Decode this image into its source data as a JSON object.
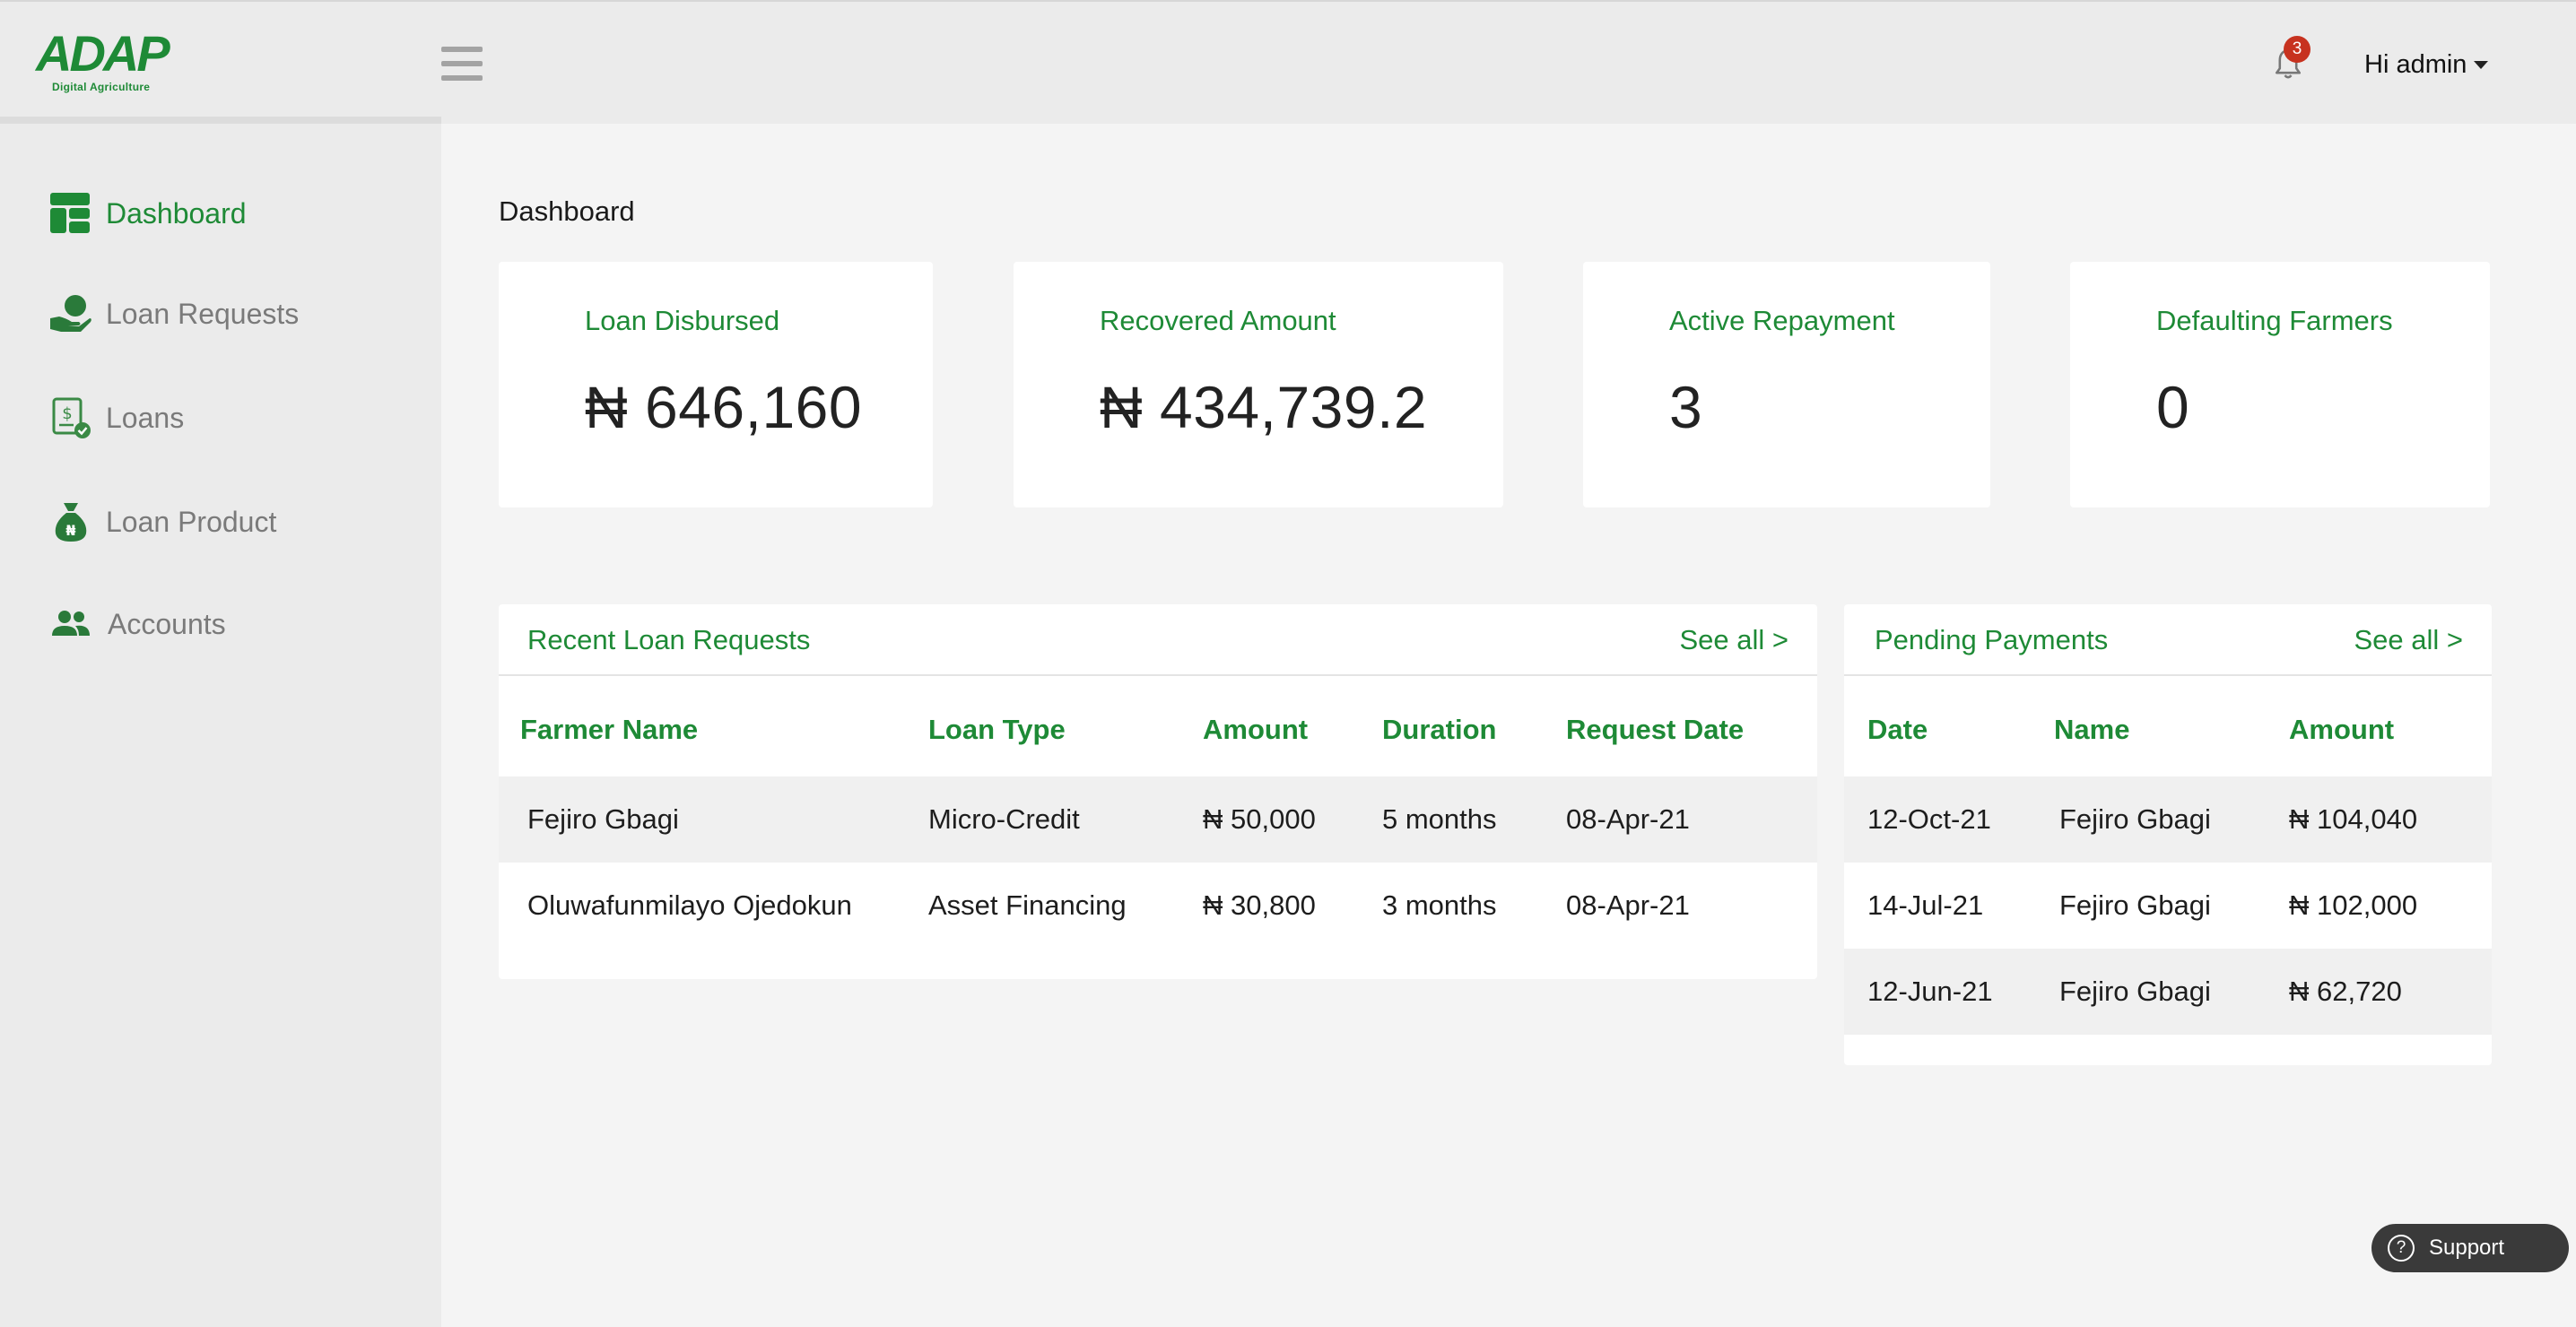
{
  "brand": {
    "name": "ADAP",
    "tagline": "Digital Agriculture"
  },
  "header": {
    "notification_count": "3",
    "user_greeting": "Hi admin"
  },
  "sidebar": {
    "items": [
      {
        "label": "Dashboard",
        "icon": "dashboard-icon",
        "active": true
      },
      {
        "label": "Loan Requests",
        "icon": "loan-requests-icon"
      },
      {
        "label": "Loans",
        "icon": "loans-icon"
      },
      {
        "label": "Loan Product",
        "icon": "money-bag-icon"
      },
      {
        "label": "Accounts",
        "icon": "users-icon"
      }
    ]
  },
  "page": {
    "title": "Dashboard"
  },
  "stats": [
    {
      "label": "Loan Disbursed",
      "value": "₦ 646,160"
    },
    {
      "label": "Recovered Amount",
      "value": "₦ 434,739.2"
    },
    {
      "label": "Active Repayment",
      "value": "3"
    },
    {
      "label": "Defaulting Farmers",
      "value": "0"
    }
  ],
  "recent_requests": {
    "title": "Recent Loan Requests",
    "see_all": "See all >",
    "columns": [
      "Farmer Name",
      "Loan Type",
      "Amount",
      "Duration",
      "Request Date"
    ],
    "rows": [
      [
        "Fejiro Gbagi",
        "Micro-Credit",
        "₦ 50,000",
        "5 months",
        "08-Apr-21"
      ],
      [
        "Oluwafunmilayo Ojedokun",
        "Asset Financing",
        "₦ 30,800",
        "3 months",
        "08-Apr-21"
      ]
    ]
  },
  "pending_payments": {
    "title": "Pending Payments",
    "see_all": "See all >",
    "columns": [
      "Date",
      "Name",
      "Amount"
    ],
    "rows": [
      [
        "12-Oct-21",
        "Fejiro Gbagi",
        "₦ 104,040"
      ],
      [
        "14-Jul-21",
        "Fejiro Gbagi",
        "₦ 102,000"
      ],
      [
        "12-Jun-21",
        "Fejiro Gbagi",
        "₦ 62,720"
      ]
    ]
  },
  "support": {
    "label": "Support"
  },
  "colors": {
    "accent": "#1e8a36",
    "badge": "#c7321f"
  }
}
